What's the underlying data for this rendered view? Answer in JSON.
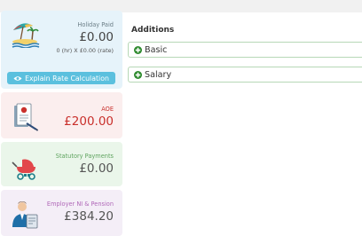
{
  "holiday": {
    "label": "Holiday Paid",
    "amount": "£0.00",
    "rate": "0 (hr) X £0.00 (rate)",
    "explain_label": "Explain Rate Calculation"
  },
  "aoe": {
    "label": "AOE",
    "amount": "£200.00"
  },
  "statutory": {
    "label": "Statutory Payments",
    "amount": "£0.00"
  },
  "employer": {
    "label": "Employer NI & Pension",
    "amount": "£384.20"
  },
  "additions": {
    "title": "Additions",
    "items": [
      {
        "label": "Basic"
      },
      {
        "label": "Salary"
      }
    ]
  },
  "colors": {
    "info": "#5bc0de",
    "success": "#3c9a3c",
    "danger": "#c9302c"
  }
}
